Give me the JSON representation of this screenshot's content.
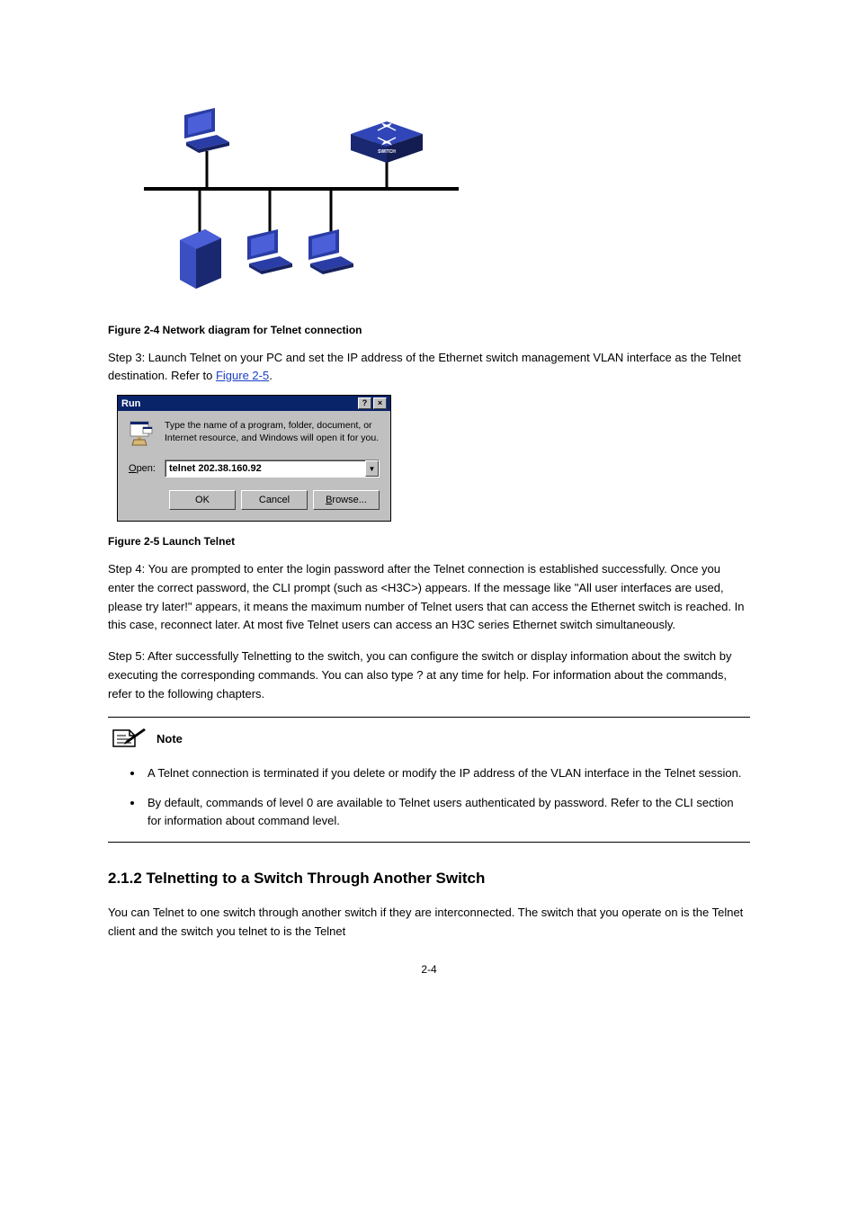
{
  "diagram": {
    "switch_label": "SWITCH",
    "caption": "Figure 2-4 Network diagram for Telnet connection"
  },
  "step3": {
    "prefix": "Step 3: Launch Telnet on your PC and set the IP address of the Ethernet switch management VLAN interface as the Telnet destination. Refer to ",
    "link": "Figure 2-5",
    "suffix": "."
  },
  "run_dialog": {
    "title": "Run",
    "desc": "Type the name of a program, folder, document, or Internet resource, and Windows will open it for you.",
    "open_label": "Open:",
    "input_value": "telnet 202.38.160.92",
    "ok": "OK",
    "cancel": "Cancel",
    "browse": "Browse..."
  },
  "caption2": "Figure 2-5 Launch Telnet",
  "step4": "Step 4: You are prompted to enter the login password after the Telnet connection is established successfully. Once you enter the correct password, the CLI prompt (such as <H3C>) appears. If the message like \"All user interfaces are used, please try later!\" appears, it means the maximum number of Telnet users that can access the Ethernet switch is reached. In this case, reconnect later. At most five Telnet users can access an H3C series Ethernet switch simultaneously.",
  "step5": "Step 5: After successfully Telnetting to the switch, you can configure the switch or display information about the switch by executing the corresponding commands. You can also type ? at any time for help. For information about the commands, refer to the following chapters.",
  "note": {
    "label": "Note",
    "bullets": [
      "A Telnet connection is terminated if you delete or modify the IP address of the VLAN interface in the Telnet session.",
      "By default, commands of level 0 are available to Telnet users authenticated by password. Refer to the CLI section for information about command level."
    ]
  },
  "heading2": "2.1.2  Telnetting to a Switch Through Another Switch",
  "para2": "You can Telnet to one switch through another switch if they are interconnected. The switch that you operate on is the Telnet client and the switch you telnet to is the Telnet",
  "page_num": "2-4"
}
